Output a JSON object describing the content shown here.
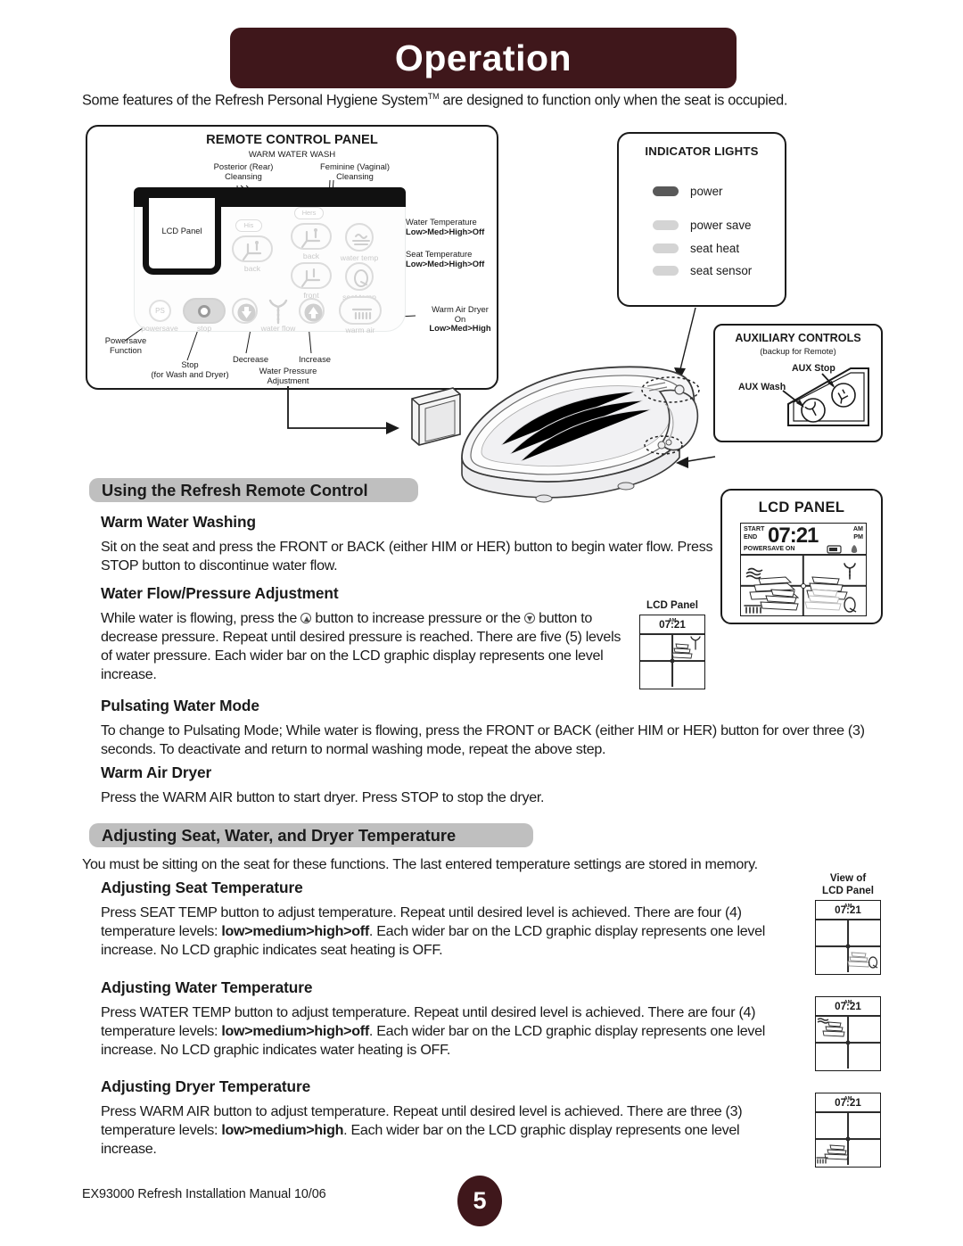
{
  "banner": {
    "title": "Operation"
  },
  "intro": {
    "text_before": "Some features of the Refresh Personal Hygiene System",
    "tm": "TM",
    "text_after": " are designed to function only when the seat is occupied."
  },
  "remote_panel": {
    "title": "REMOTE CONTROL PANEL",
    "subtitle": "WARM WATER WASH",
    "lcd_label": "LCD Panel",
    "callouts": {
      "posterior": "Posterior (Rear)\nCleansing",
      "posterior_l1": "Posterior (Rear)",
      "posterior_l2": "Cleansing",
      "feminine_l1": "Feminine (Vaginal)",
      "feminine_l2": "Cleansing",
      "water_temp_l1": "Water Temperature",
      "water_temp_l2": "Low>Med>High>Off",
      "seat_temp_l1": "Seat Temperature",
      "seat_temp_l2": "Low>Med>High>Off",
      "warm_air_l1": "Warm Air Dryer",
      "warm_air_l2": "On",
      "warm_air_l3": "Low>Med>High",
      "powersave_l1": "Powersave",
      "powersave_l2": "Function",
      "stop_l1": "Stop",
      "stop_l2": "(for Wash and Dryer)",
      "decrease": "Decrease",
      "increase": "Increase",
      "pressure_l1": "Water Pressure",
      "pressure_l2": "Adjustment"
    },
    "buttons": {
      "his": "His",
      "hers": "Hers",
      "back_left": "back",
      "back_right": "back",
      "front": "front",
      "water_temp": "water temp",
      "seat_temp": "seat temp",
      "powersave_abbr": "PS",
      "powersave": "powersave",
      "stop": "stop",
      "water_flow": "water flow",
      "warm_air": "warm air"
    }
  },
  "indicator_lights": {
    "title": "INDICATOR LIGHTS",
    "items": [
      {
        "label": "power",
        "color": "#595959"
      },
      {
        "label": "power save",
        "color": "#d4d4d4"
      },
      {
        "label": "seat heat",
        "color": "#d4d4d4"
      },
      {
        "label": "seat sensor",
        "color": "#d4d4d4"
      }
    ]
  },
  "auxiliary_controls": {
    "title": "AUXILIARY CONTROLS",
    "subtitle": "(backup for Remote)",
    "aux_stop": "AUX Stop",
    "aux_wash": "AUX Wash"
  },
  "section1": {
    "header": "Using the Refresh Remote Control",
    "items": [
      {
        "heading": "Warm Water Washing",
        "body": "Sit on the seat and press the FRONT or BACK (either HIM or HER) button to begin water flow.  Press STOP button to discontinue water flow."
      },
      {
        "heading": "Water Flow/Pressure Adjustment",
        "body_p1": "While water is flowing, press the ",
        "body_p2": " button to increase pressure or the ",
        "body_p3": " button to decrease pressure.  Repeat until desired pressure is reached.  There are five (5) levels of water pressure.  Each wider bar on the LCD graphic display represents one level increase."
      },
      {
        "heading": "Pulsating Water Mode",
        "body": "To change to Pulsating Mode; While water is flowing, press the FRONT or BACK (either HIM or HER) button for over three (3) seconds.  To deactivate and return to normal washing mode, repeat the above step."
      },
      {
        "heading": "Warm Air Dryer",
        "body": "Press the WARM AIR button to start dryer.  Press STOP to stop the dryer."
      }
    ]
  },
  "section2": {
    "header": "Adjusting Seat, Water, and Dryer Temperature",
    "intro": "You must be sitting on the seat for these functions.  The last entered temperature settings are stored in memory.",
    "items": [
      {
        "heading": "Adjusting Seat Temperature",
        "p1": "Press SEAT TEMP button to adjust temperature.  Repeat until desired level is achieved.  There are four (4) temperature levels: ",
        "bold": "low>medium>high>off",
        "p2": ".  Each wider bar on the LCD graphic display represents one level increase.  No LCD graphic indicates seat heating is OFF."
      },
      {
        "heading": "Adjusting Water Temperature",
        "p1": "Press WATER TEMP button to adjust temperature.  Repeat until desired level is achieved.  There are four (4) temperature levels: ",
        "bold": "low>medium>high>off",
        "p2": ".  Each wider bar on the LCD graphic display represents one level increase.  No LCD graphic indicates water heating is OFF."
      },
      {
        "heading": "Adjusting Dryer Temperature",
        "p1": "Press WARM AIR button to adjust temperature.  Repeat until desired level is achieved.  There are three (3) temperature levels: ",
        "bold": "low>medium>high",
        "p2": ".  Each wider bar on the LCD graphic display represents one level increase."
      }
    ]
  },
  "lcd_panel_big": {
    "title": "LCD PANEL",
    "start": "START",
    "end": "END",
    "time": "07:21",
    "am": "AM",
    "pm": "PM",
    "powersave": "POWERSAVE  ON"
  },
  "lcd_mini_pressure": {
    "caption": "LCD Panel",
    "time": "07:21",
    "ampm": "AM"
  },
  "lcd_mini_views": {
    "caption_l1": "View of",
    "caption_l2": "LCD Panel",
    "views": [
      {
        "name": "seat-temperature",
        "time": "07:21",
        "ampm": "AM"
      },
      {
        "name": "water-temperature",
        "time": "07:21",
        "ampm": "AM"
      },
      {
        "name": "dryer-temperature",
        "time": "07:21",
        "ampm": "AM"
      }
    ]
  },
  "footer": {
    "text": "EX93000   Refresh Installation Manual  10/06",
    "page_number": "5"
  },
  "colors": {
    "brand_maroon": "#3F171B",
    "section_bar_gray": "#BFBFBF",
    "led_on": "#595959",
    "led_off": "#d4d4d4"
  }
}
